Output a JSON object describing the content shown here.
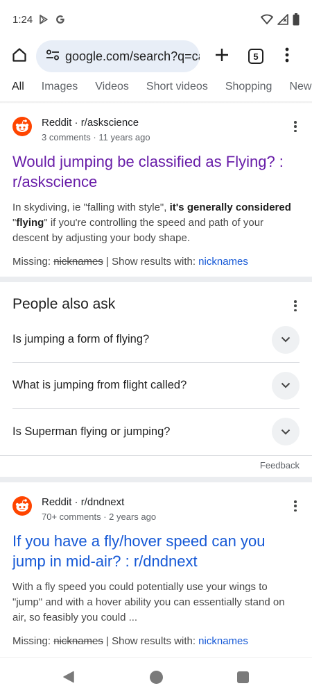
{
  "status_bar": {
    "time": "1:24",
    "left_icons": [
      "play-store-icon",
      "google-g-icon"
    ],
    "right_icons": [
      "wifi-icon",
      "signal-icon",
      "battery-icon"
    ]
  },
  "toolbar": {
    "url": "google.com/search?q=ca",
    "tab_count": "5",
    "icons": [
      "home-icon",
      "site-settings-icon",
      "new-tab-icon",
      "overflow-menu-icon"
    ]
  },
  "filter_tabs": [
    "All",
    "Images",
    "Videos",
    "Short videos",
    "Shopping",
    "News"
  ],
  "results": [
    {
      "source": "Reddit · r/askscience",
      "meta": "3 comments · 11 years ago",
      "title_line1": "Would jumping be classified as Flying? :",
      "title_line2": "r/askscience",
      "snippet_part1": "In skydiving, ie \"falling with style\", ",
      "snippet_bold1": "it's generally considered",
      "snippet_part2": " \"",
      "snippet_bold2": "flying",
      "snippet_part3": "\" if you're controlling the speed and path of your descent by adjusting your body shape.",
      "missing_label": "Missing: ",
      "missing_term": "nicknames",
      "show_label": " | Show results with: ",
      "show_term": "nicknames"
    },
    {
      "source": "Reddit · r/dndnext",
      "meta": "70+ comments · 2 years ago",
      "title_line1": "If you have a fly/hover speed can you",
      "title_line2": "jump in mid-air? : r/dndnext",
      "snippet": "With a fly speed you could potentially use your wings to \"jump\" and with a hover ability you can essentially stand on air, so feasibly you could ...",
      "missing_label": "Missing: ",
      "missing_term": "nicknames",
      "show_label": " | Show results with: ",
      "show_term": "nicknames"
    }
  ],
  "people_also_ask": {
    "heading": "People also ask",
    "questions": [
      "Is jumping a form of flying?",
      "What is jumping from flight called?",
      "Is Superman flying or jumping?"
    ],
    "feedback": "Feedback"
  },
  "colors": {
    "visited_link": "#681da8",
    "link": "#1558d6",
    "reddit_orange": "#ff4500",
    "omnibox_bg": "#e8eef7"
  }
}
